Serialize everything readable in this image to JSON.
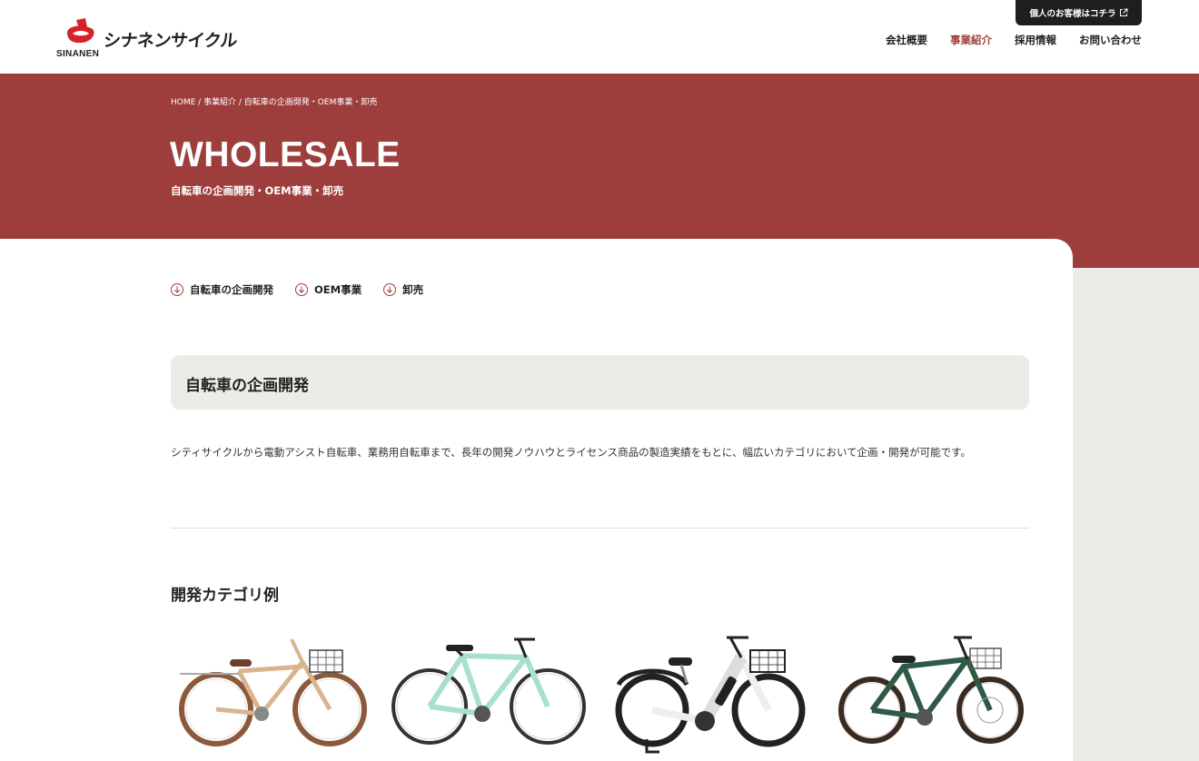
{
  "header": {
    "logo_wordmark": "シナネンサイクル",
    "logo_sub": "SINANEN",
    "personal_button": "個人のお客様はコチラ",
    "nav": [
      {
        "label": "会社概要",
        "active": false
      },
      {
        "label": "事業紹介",
        "active": true
      },
      {
        "label": "採用情報",
        "active": false
      },
      {
        "label": "お問い合わせ",
        "active": false
      }
    ]
  },
  "hero": {
    "breadcrumb": "HOME / 事業紹介 / 自転車の企画開発・OEM事業・卸売",
    "title": "WHOLESALE",
    "subtitle": "自転車の企画開発・OEM事業・卸売"
  },
  "anchors": [
    {
      "label": "自転車の企画開発"
    },
    {
      "label": "OEM事業"
    },
    {
      "label": "卸売"
    }
  ],
  "section": {
    "title": "自転車の企画開発",
    "body": "シティサイクルから電動アシスト自転車、業務用自転車まで、長年の開発ノウハウとライセンス商品の製造実績をもとに、幅広いカテゴリにおいて企画・開発が可能です。",
    "categories_title": "開発カテゴリ例"
  },
  "bikes": [
    {
      "name": "city-bike",
      "frame_color": "#d9b48f",
      "tire_color": "#8a5a3a"
    },
    {
      "name": "cross-bike",
      "frame_color": "#a8e0d0",
      "tire_color": "#333333"
    },
    {
      "name": "e-assist-bike",
      "frame_color": "#eeeeee",
      "tire_color": "#222222"
    },
    {
      "name": "kids-bike",
      "frame_color": "#2f5a46",
      "tire_color": "#3a2a22"
    }
  ],
  "colors": {
    "brand_red": "#9e3e3c",
    "beige": "#ecebe7",
    "dark": "#1e1e1e"
  }
}
